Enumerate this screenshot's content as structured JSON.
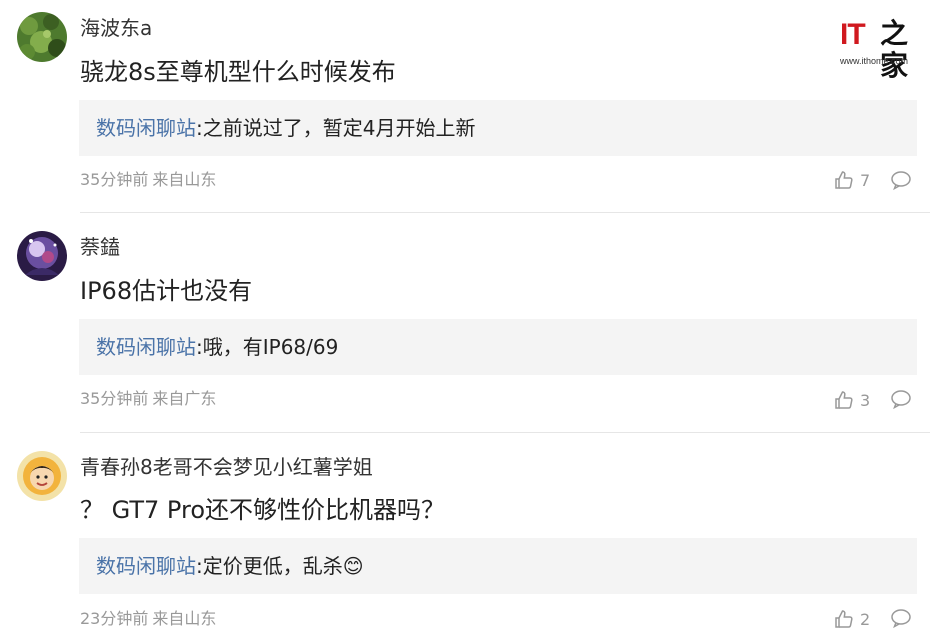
{
  "watermark": {
    "brand": "IT之家",
    "url": "www.ithome.com"
  },
  "comments": [
    {
      "username": "海波东a",
      "content": "骁龙8s至尊机型什么时候发布",
      "reply": {
        "name": "数码闲聊站",
        "text": ":之前说过了，暂定4月开始上新"
      },
      "time": "35分钟前",
      "location": "来自山东",
      "likes": "7"
    },
    {
      "username": "萘鎑",
      "content": "IP68估计也没有",
      "reply": {
        "name": "数码闲聊站",
        "text": ":哦，有IP68/69"
      },
      "time": "35分钟前",
      "location": "来自广东",
      "likes": "3"
    },
    {
      "username": "青春孙8老哥不会梦见小红薯学姐",
      "content": "？ GT7 Pro还不够性价比机器吗？",
      "reply": {
        "name": "数码闲聊站",
        "text": ":定价更低，乱杀",
        "emoji": "😊"
      },
      "time": "23分钟前",
      "location": "来自山东",
      "likes": "2"
    }
  ],
  "colors": {
    "reply_name": "#4a73a8",
    "meta": "#999999",
    "reply_bg": "#f4f4f4",
    "logo_red": "#d0191f"
  },
  "icons": {
    "like": "thumbs-up-icon",
    "reply": "speech-bubble-icon"
  }
}
